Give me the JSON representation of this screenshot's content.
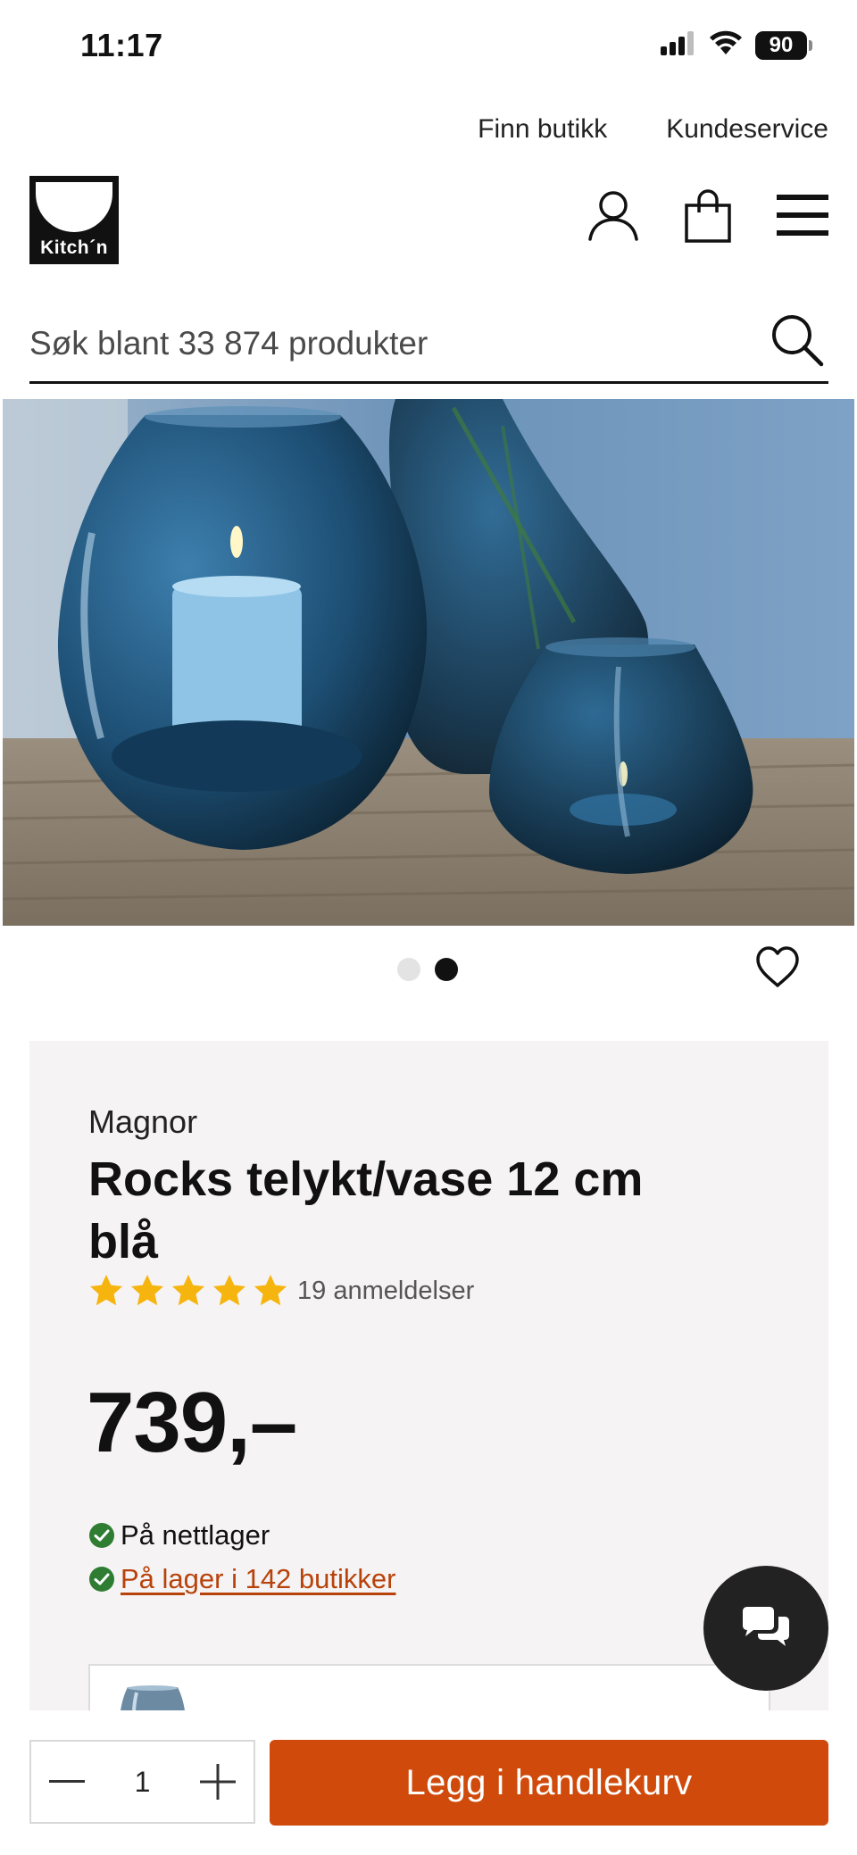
{
  "status_bar": {
    "time": "11:17",
    "battery": "90",
    "icons": [
      "signal-icon",
      "wifi-icon",
      "battery-icon"
    ]
  },
  "utility_nav": {
    "find_store": "Finn butikk",
    "customer_service": "Kundeservice"
  },
  "header": {
    "logo_text": "Kitch´n",
    "icons": [
      "account-icon",
      "shopping-bag-icon",
      "menu-icon"
    ]
  },
  "search": {
    "placeholder": "Søk blant 33 874 produkter"
  },
  "gallery": {
    "image_count": 2,
    "active_index": 2,
    "favorite_icon": "heart-icon"
  },
  "product": {
    "brand": "Magnor",
    "title": "Rocks telykt/vase 12 cm blå",
    "rating": 5,
    "rating_max": 5,
    "reviews": "19 anmeldelser",
    "price": "739,–",
    "stock_online": "På nettlager",
    "stock_stores": "På lager i 142 butikker"
  },
  "cart_bar": {
    "quantity": "1",
    "add_to_cart": "Legg i handlekurv"
  },
  "colors": {
    "accent": "#cf4a0b",
    "stock_green": "#2e7d32",
    "card_bg": "#f5f3f3",
    "star": "#f6b40e"
  }
}
